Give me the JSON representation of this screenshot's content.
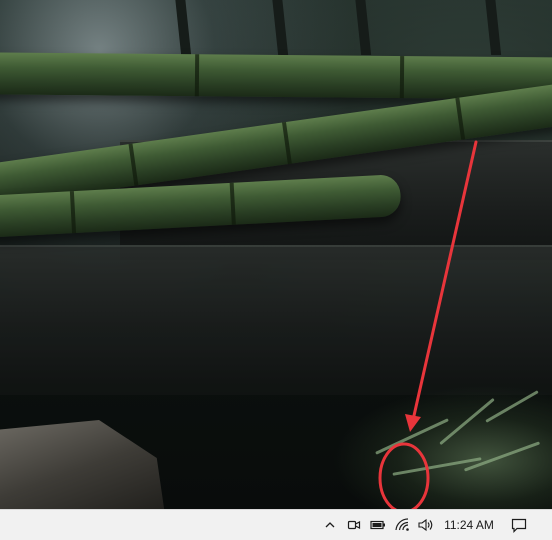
{
  "taskbar": {
    "clock_time": "11:24 AM",
    "tray_icons": [
      "chevron-up-icon",
      "meet-now-icon",
      "battery-icon",
      "wifi-icon",
      "speaker-icon",
      "notification-icon"
    ]
  },
  "annotation": {
    "arrow_color": "#e8353b",
    "ellipse_color": "#e8353b"
  }
}
